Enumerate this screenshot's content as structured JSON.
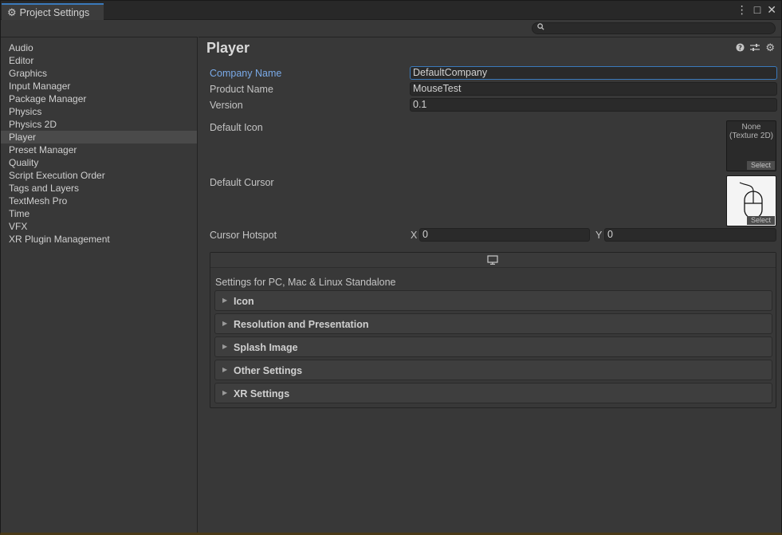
{
  "window": {
    "tab_title": "Project Settings",
    "menu_icon": "kebab-menu-icon",
    "close_icon": "close-icon"
  },
  "search": {
    "placeholder": "",
    "value": ""
  },
  "sidebar": {
    "items": [
      {
        "label": "Audio"
      },
      {
        "label": "Editor"
      },
      {
        "label": "Graphics"
      },
      {
        "label": "Input Manager"
      },
      {
        "label": "Package Manager"
      },
      {
        "label": "Physics"
      },
      {
        "label": "Physics 2D"
      },
      {
        "label": "Player",
        "selected": true
      },
      {
        "label": "Preset Manager"
      },
      {
        "label": "Quality"
      },
      {
        "label": "Script Execution Order"
      },
      {
        "label": "Tags and Layers"
      },
      {
        "label": "TextMesh Pro"
      },
      {
        "label": "Time"
      },
      {
        "label": "VFX"
      },
      {
        "label": "XR Plugin Management"
      }
    ]
  },
  "main": {
    "title": "Player",
    "company_name_label": "Company Name",
    "company_name_value": "DefaultCompany",
    "product_name_label": "Product Name",
    "product_name_value": "MouseTest",
    "version_label": "Version",
    "version_value": "0.1",
    "default_icon_label": "Default Icon",
    "default_icon_none_1": "None",
    "default_icon_none_2": "(Texture 2D)",
    "select_label": "Select",
    "default_cursor_label": "Default Cursor",
    "cursor_hotspot_label": "Cursor Hotspot",
    "hotspot_x_label": "X",
    "hotspot_x_value": "0",
    "hotspot_y_label": "Y",
    "hotspot_y_value": "0",
    "platform_title": "Settings for PC, Mac & Linux Standalone",
    "foldouts": [
      {
        "label": "Icon"
      },
      {
        "label": "Resolution and Presentation"
      },
      {
        "label": "Splash Image"
      },
      {
        "label": "Other Settings"
      },
      {
        "label": "XR Settings"
      }
    ]
  },
  "colors": {
    "accent": "#3a79bb",
    "active_label": "#7aaae8",
    "background": "#383838"
  }
}
